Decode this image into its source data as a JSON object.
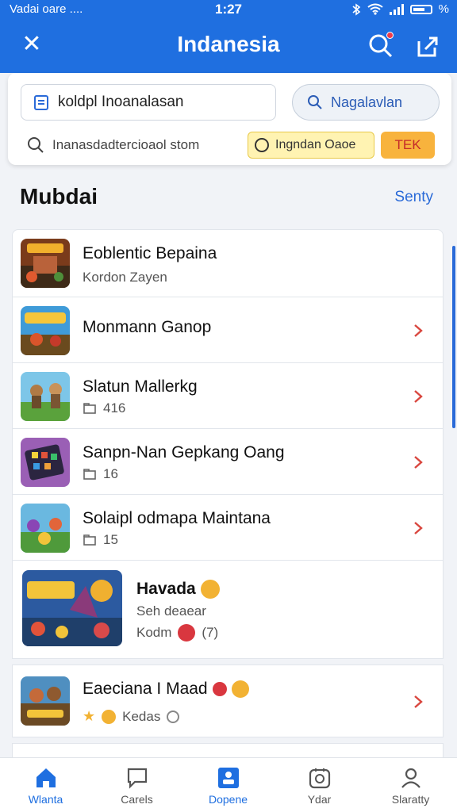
{
  "status_bar": {
    "carrier": "Vadai oare ....",
    "time": "1:27",
    "battery": "%"
  },
  "header": {
    "title": "Indanesia"
  },
  "search": {
    "field_value": "koldpl Inoanalasan",
    "button_label": "Nagalavlan",
    "query": "Inanasdadtercioaol stom",
    "chip_yellow": "Ingndan Oaoe",
    "chip_orange": "TEK"
  },
  "section": {
    "title": "Mubdai",
    "link": "Senty"
  },
  "list": [
    {
      "title": "Eoblentic Bepaina",
      "subtitle": "Kordon Zayen",
      "has_chevron": false
    },
    {
      "title": "Monmann Ganop",
      "subtitle": "",
      "has_chevron": true
    },
    {
      "title": "Slatun Mallerkg",
      "count": "416",
      "has_chevron": true
    },
    {
      "title": "Sanpn-Nan Gepkang Oang",
      "count": "16",
      "has_chevron": true
    },
    {
      "title": "Solaipl odmapa Maintana",
      "count": "15",
      "has_chevron": true
    },
    {
      "title": "Havada",
      "line2": "Seh deaear",
      "line3": "Kodm",
      "extra": "(7)",
      "has_chevron": false
    },
    {
      "title": "Eaeciana I Maad",
      "subtitle": "Kedas",
      "has_chevron": true
    }
  ],
  "bottom_nav": [
    {
      "label": "Wlanta",
      "active": true
    },
    {
      "label": "Carels",
      "active": false
    },
    {
      "label": "Dopene",
      "active": true
    },
    {
      "label": "Ydar",
      "active": false
    },
    {
      "label": "Slaratty",
      "active": false
    }
  ],
  "colors": {
    "primary": "#1f6fe0",
    "chevron": "#d9473f",
    "chip_yellow": "#fff3b2",
    "chip_orange": "#f8b33d"
  }
}
